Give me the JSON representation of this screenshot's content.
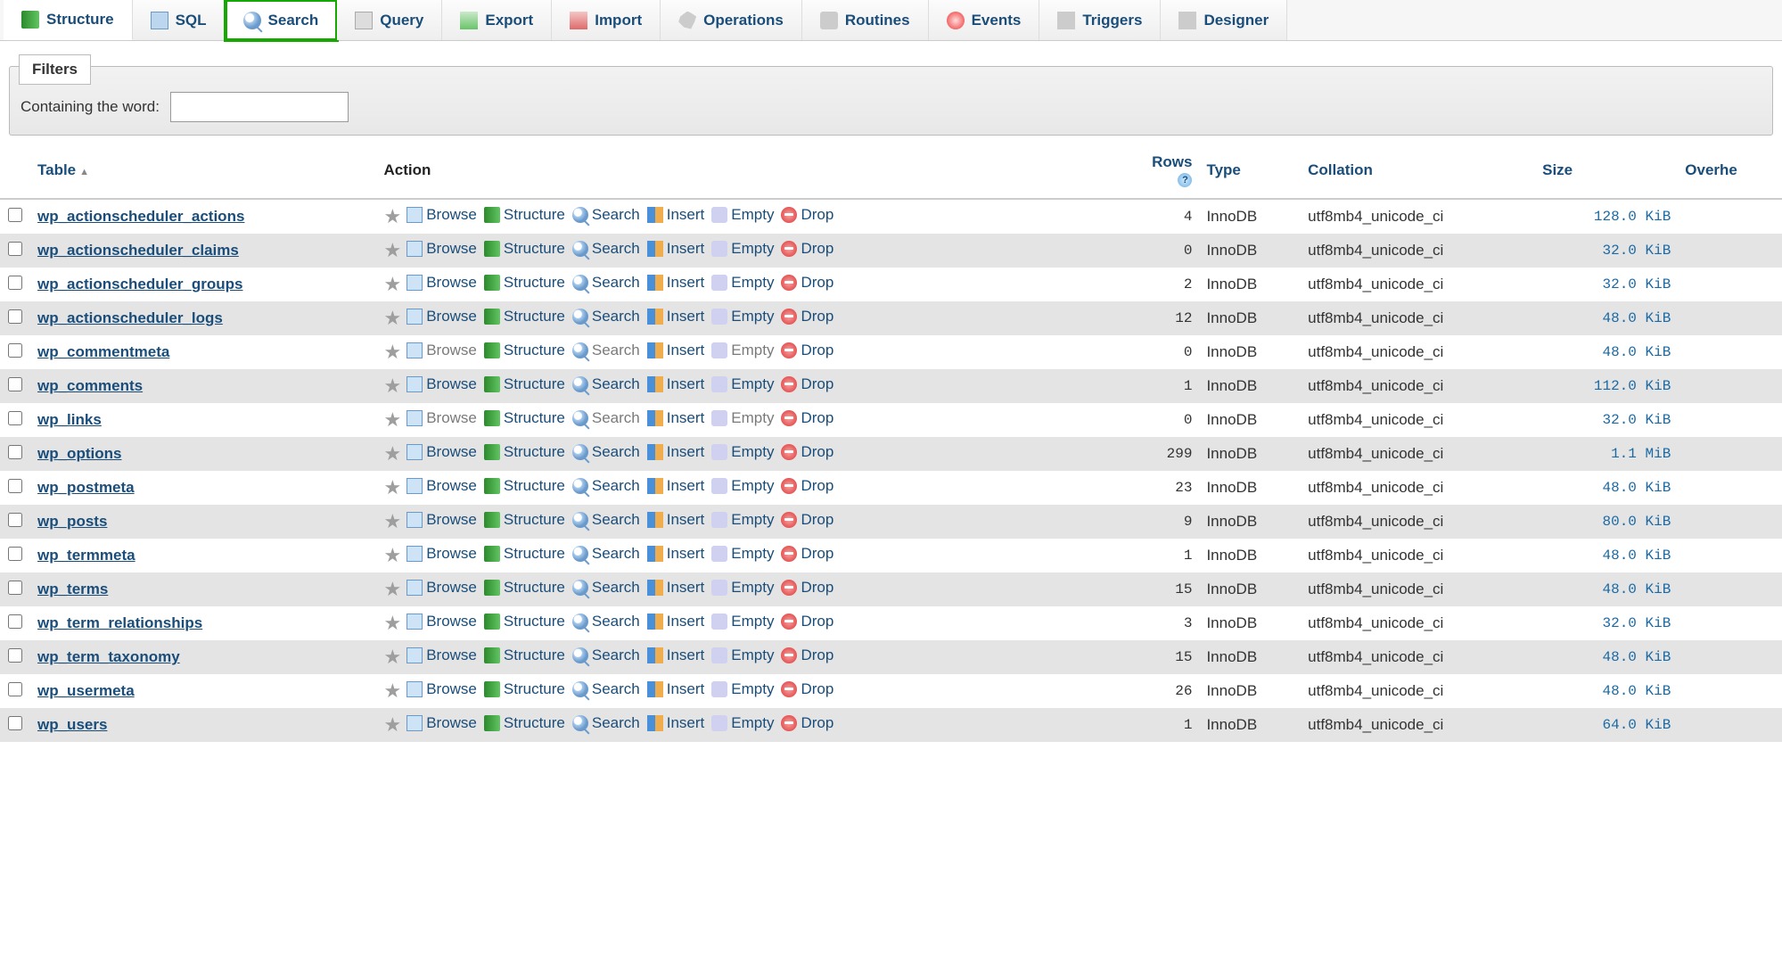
{
  "tabs": [
    {
      "label": "Structure",
      "icon": "structure"
    },
    {
      "label": "SQL",
      "icon": "sql"
    },
    {
      "label": "Search",
      "icon": "search",
      "highlighted": true
    },
    {
      "label": "Query",
      "icon": "query"
    },
    {
      "label": "Export",
      "icon": "export"
    },
    {
      "label": "Import",
      "icon": "import"
    },
    {
      "label": "Operations",
      "icon": "operations"
    },
    {
      "label": "Routines",
      "icon": "routines"
    },
    {
      "label": "Events",
      "icon": "events"
    },
    {
      "label": "Triggers",
      "icon": "triggers"
    },
    {
      "label": "Designer",
      "icon": "designer"
    }
  ],
  "filters": {
    "groupLabel": "Filters",
    "containingLabel": "Containing the word:",
    "containingValue": ""
  },
  "columns": {
    "table": "Table",
    "action": "Action",
    "rows": "Rows",
    "type": "Type",
    "collation": "Collation",
    "size": "Size",
    "overhead": "Overhe"
  },
  "actionLabels": {
    "browse": "Browse",
    "structure": "Structure",
    "search": "Search",
    "insert": "Insert",
    "empty": "Empty",
    "drop": "Drop"
  },
  "tables": [
    {
      "name": "wp_actionscheduler_actions",
      "rows": 4,
      "type": "InnoDB",
      "collation": "utf8mb4_unicode_ci",
      "size": "128.0 KiB",
      "dim": false
    },
    {
      "name": "wp_actionscheduler_claims",
      "rows": 0,
      "type": "InnoDB",
      "collation": "utf8mb4_unicode_ci",
      "size": "32.0 KiB",
      "dim": false
    },
    {
      "name": "wp_actionscheduler_groups",
      "rows": 2,
      "type": "InnoDB",
      "collation": "utf8mb4_unicode_ci",
      "size": "32.0 KiB",
      "dim": false
    },
    {
      "name": "wp_actionscheduler_logs",
      "rows": 12,
      "type": "InnoDB",
      "collation": "utf8mb4_unicode_ci",
      "size": "48.0 KiB",
      "dim": false
    },
    {
      "name": "wp_commentmeta",
      "rows": 0,
      "type": "InnoDB",
      "collation": "utf8mb4_unicode_ci",
      "size": "48.0 KiB",
      "dim": true
    },
    {
      "name": "wp_comments",
      "rows": 1,
      "type": "InnoDB",
      "collation": "utf8mb4_unicode_ci",
      "size": "112.0 KiB",
      "dim": false
    },
    {
      "name": "wp_links",
      "rows": 0,
      "type": "InnoDB",
      "collation": "utf8mb4_unicode_ci",
      "size": "32.0 KiB",
      "dim": true
    },
    {
      "name": "wp_options",
      "rows": 299,
      "type": "InnoDB",
      "collation": "utf8mb4_unicode_ci",
      "size": "1.1 MiB",
      "dim": false
    },
    {
      "name": "wp_postmeta",
      "rows": 23,
      "type": "InnoDB",
      "collation": "utf8mb4_unicode_ci",
      "size": "48.0 KiB",
      "dim": false
    },
    {
      "name": "wp_posts",
      "rows": 9,
      "type": "InnoDB",
      "collation": "utf8mb4_unicode_ci",
      "size": "80.0 KiB",
      "dim": false
    },
    {
      "name": "wp_termmeta",
      "rows": 1,
      "type": "InnoDB",
      "collation": "utf8mb4_unicode_ci",
      "size": "48.0 KiB",
      "dim": false
    },
    {
      "name": "wp_terms",
      "rows": 15,
      "type": "InnoDB",
      "collation": "utf8mb4_unicode_ci",
      "size": "48.0 KiB",
      "dim": false
    },
    {
      "name": "wp_term_relationships",
      "rows": 3,
      "type": "InnoDB",
      "collation": "utf8mb4_unicode_ci",
      "size": "32.0 KiB",
      "dim": false
    },
    {
      "name": "wp_term_taxonomy",
      "rows": 15,
      "type": "InnoDB",
      "collation": "utf8mb4_unicode_ci",
      "size": "48.0 KiB",
      "dim": false
    },
    {
      "name": "wp_usermeta",
      "rows": 26,
      "type": "InnoDB",
      "collation": "utf8mb4_unicode_ci",
      "size": "48.0 KiB",
      "dim": false
    },
    {
      "name": "wp_users",
      "rows": 1,
      "type": "InnoDB",
      "collation": "utf8mb4_unicode_ci",
      "size": "64.0 KiB",
      "dim": false
    }
  ]
}
